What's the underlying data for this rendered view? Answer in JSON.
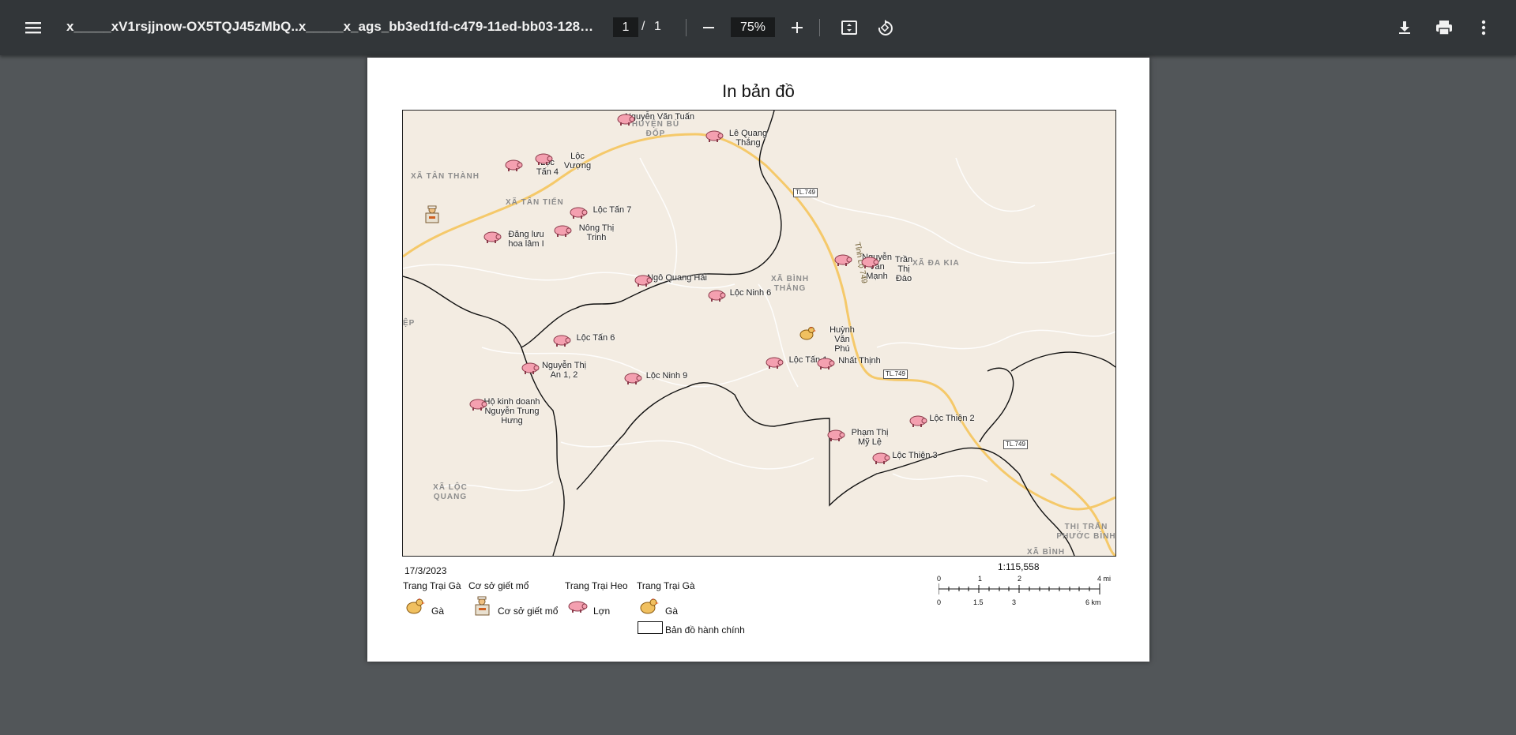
{
  "toolbar": {
    "menu_icon": "hamburger-menu-icon",
    "title": "x_____xV1rsjjnow-OX5TQJ45zMbQ..x_____x_ags_bb3ed1fd-c479-11ed-bb03-128668...",
    "current_page": "1",
    "page_separator": "/",
    "total_pages": "1",
    "zoom": "75%",
    "icons": [
      "zoom-out-icon",
      "zoom-in-icon",
      "fit-page-icon",
      "rotate-icon",
      "download-icon",
      "print-icon",
      "more-vert-icon"
    ]
  },
  "page": {
    "heading": "In bản đồ",
    "date": "17/3/2023",
    "scale_ratio": "1:115,558"
  },
  "map": {
    "farms": [
      {
        "label": "Nguyễn Văn Tuấn",
        "type": "pig"
      },
      {
        "label": "Lê Quang Thắng",
        "type": "pig"
      },
      {
        "label": "Lộc Tấn 4",
        "type": "pig"
      },
      {
        "label": "Lộc Vượng",
        "type": "pig"
      },
      {
        "label": "Lộc Tấn 7",
        "type": "pig"
      },
      {
        "label": "Đăng lưu hoa lâm I",
        "type": "pig"
      },
      {
        "label": "Nông Thị Trinh",
        "type": "pig"
      },
      {
        "label": "Ngô Quang Hải",
        "type": "pig"
      },
      {
        "label": "Lộc Ninh 6",
        "type": "pig"
      },
      {
        "label": "Nguyễn Văn Mạnh",
        "type": "pig"
      },
      {
        "label": "Trần Thị Đào",
        "type": "pig"
      },
      {
        "label": "Lộc Tấn 6",
        "type": "pig"
      },
      {
        "label": "Nguyễn Thị An 1, 2",
        "type": "pig"
      },
      {
        "label": "Lộc Ninh 9",
        "type": "pig"
      },
      {
        "label": "Huỳnh Văn Phú",
        "type": "chicken"
      },
      {
        "label": "Lộc Tấn 1",
        "type": "pig"
      },
      {
        "label": "Nhất Thịnh",
        "type": "pig"
      },
      {
        "label": "Hộ kinh doanh Nguyễn Trung Hưng",
        "type": "pig"
      },
      {
        "label": "Phạm Thị Mỹ Lệ",
        "type": "pig"
      },
      {
        "label": "Lộc Thiện 2",
        "type": "pig"
      },
      {
        "label": "Lộc Thiện 3",
        "type": "pig"
      }
    ],
    "regions": [
      "XÃ TÂN THÀNH",
      "XÃ TÂN TIẾN",
      "HUYỆN BÙ ĐỐP",
      "XÃ BÌNH THẮNG",
      "XÃ ĐA KIA",
      "ỆP",
      "XÃ LỘC QUANG",
      "THỊ TRẤN PHƯỚC BÌNH",
      "XÃ BÌNH"
    ],
    "road_labels": [
      "TL.749",
      "TL.749",
      "TL.749"
    ],
    "road_name": "Tỉnh Lộ 749"
  },
  "legend": {
    "headers": [
      "Trang Trại Gà",
      "Cơ sở giết mổ",
      "Trang Trại Heo",
      "Trang Trại Gà"
    ],
    "items": [
      "Gà",
      "Cơ sở giết mổ",
      "Lợn",
      "Gà"
    ],
    "admin_map": "Bản đồ hành chính"
  },
  "scale": {
    "mi_ticks": [
      "0",
      "1",
      "2",
      "4 mi"
    ],
    "km_ticks": [
      "0",
      "1.5",
      "3",
      "6 km"
    ]
  }
}
